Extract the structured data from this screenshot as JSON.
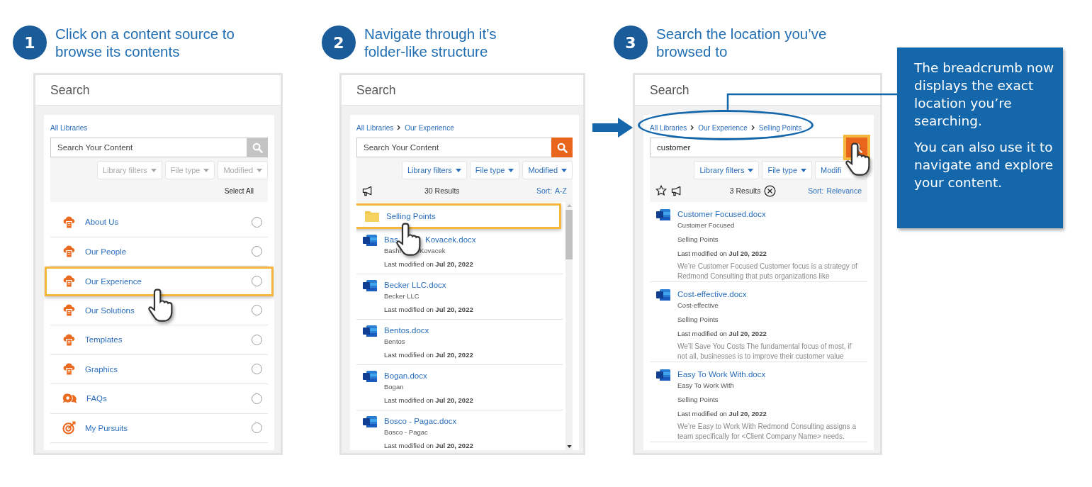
{
  "steps": [
    {
      "number": "1",
      "title": "Click on a content source to\nbrowse its contents",
      "panel": {
        "title": "Search",
        "breadcrumb": [
          {
            "label": "All Libraries"
          }
        ],
        "search": {
          "placeholder": "Search Your Content",
          "disabled": true,
          "highlighted": false
        },
        "filters": [
          {
            "label": "Library filters",
            "disabled": true
          },
          {
            "label": "File type",
            "disabled": true
          },
          {
            "label": "Modified",
            "disabled": true
          }
        ],
        "select_all": "Select All",
        "list": {
          "kind": "sources",
          "items": [
            {
              "kind": "library",
              "label": "About Us",
              "selected": false,
              "highlighted": false
            },
            {
              "kind": "library",
              "label": "Our People",
              "selected": false,
              "highlighted": false
            },
            {
              "kind": "library",
              "label": "Our Experience",
              "selected": false,
              "highlighted": true
            },
            {
              "kind": "library",
              "label": "Our Solutions",
              "selected": false,
              "highlighted": false
            },
            {
              "kind": "library",
              "label": "Templates",
              "selected": false,
              "highlighted": false
            },
            {
              "kind": "library",
              "label": "Graphics",
              "selected": false,
              "highlighted": false
            },
            {
              "kind": "faq",
              "label": "FAQs",
              "selected": false,
              "highlighted": false
            },
            {
              "kind": "target",
              "label": "My Pursuits",
              "selected": false,
              "highlighted": false
            }
          ]
        }
      }
    },
    {
      "number": "2",
      "title": "Navigate through it’s\nfolder-like structure",
      "panel": {
        "title": "Search",
        "breadcrumb": [
          {
            "label": "All Libraries"
          },
          {
            "label": "Our Experience"
          }
        ],
        "search": {
          "placeholder": "Search Your Content",
          "disabled": false,
          "highlighted": false
        },
        "filters": [
          {
            "label": "Library filters",
            "disabled": false
          },
          {
            "label": "File type",
            "disabled": false
          },
          {
            "label": "Modified",
            "disabled": false
          }
        ],
        "results": {
          "count": "30 Results",
          "sort_label": "Sort:",
          "sort_value": "A-Z"
        },
        "list": {
          "kind": "results",
          "items": [
            {
              "kind": "folder",
              "title": "Selling Points",
              "highlighted": true
            },
            {
              "kind": "document",
              "title": "Bas",
              "title_end": "Kovacek.docx",
              "subtitle": "Bashi",
              "subtitle_end": "Kovacek",
              "date": "Last modified on **Jul 20, 2022**"
            },
            {
              "kind": "document",
              "title": "Becker LLC.docx",
              "subtitle": "Becker LLC",
              "date": "Last modified on **Jul 20, 2022**"
            },
            {
              "kind": "document",
              "title": "Bentos.docx",
              "subtitle": "Bentos",
              "date": "Last modified on **Jul 20, 2022**"
            },
            {
              "kind": "document",
              "title": "Bogan.docx",
              "subtitle": "Bogan",
              "date": "Last modified on **Jul 20, 2022**"
            },
            {
              "kind": "document",
              "title": "Bosco - Pagac.docx",
              "subtitle": "Bosco - Pagac",
              "date": "Last modified on **Jul 20, 2022**"
            }
          ]
        }
      }
    },
    {
      "number": "3",
      "title": "Search the location you’ve\nbrowsed to",
      "panel": {
        "title": "Search",
        "breadcrumb": [
          {
            "label": "All Libraries"
          },
          {
            "label": "Our Experience"
          },
          {
            "label": "Selling Points"
          }
        ],
        "breadcrumb_circled": true,
        "search": {
          "value": "customer",
          "disabled": false,
          "highlighted": true
        },
        "filters": [
          {
            "label": "Library filters",
            "disabled": false
          },
          {
            "label": "File type",
            "disabled": false
          },
          {
            "label": "Modifi",
            "disabled": false
          }
        ],
        "results": {
          "count": "3 Results",
          "sort_label": "Sort:",
          "sort_value": "Relevance",
          "show_star": true,
          "clearable": true
        },
        "list": {
          "kind": "results",
          "items": [
            {
              "kind": "document",
              "title": "Customer Focused.docx",
              "subtitle": "Customer Focused",
              "location": "Selling Points",
              "date": "Last modified on **Jul 20, 2022**",
              "summary": "We’re Customer Focused Customer focus is a strategy of Redmond Consulting that puts organizations like"
            },
            {
              "kind": "document",
              "title": "Cost-effective.docx",
              "subtitle": "Cost-effective",
              "location": "Selling Points",
              "date": "Last modified on **Jul 20, 2022**",
              "summary": "We’ll Save You Costs The fundamental focus of most, if not all, businesses is to improve their customer value"
            },
            {
              "kind": "document",
              "title": "Easy To Work With.docx",
              "subtitle": "Easy To Work With",
              "location": "Selling Points",
              "date": "Last modified on **Jul 20, 2022**",
              "summary": "We’re Easy to Work With Redmond Consulting assigns a team specifically for <Client Company Name> needs."
            }
          ]
        }
      }
    }
  ],
  "callout": {
    "paragraphs": [
      "The breadcrumb now displays the exact location you’re searching.",
      "You can also use it to navigate and explore your content."
    ]
  }
}
